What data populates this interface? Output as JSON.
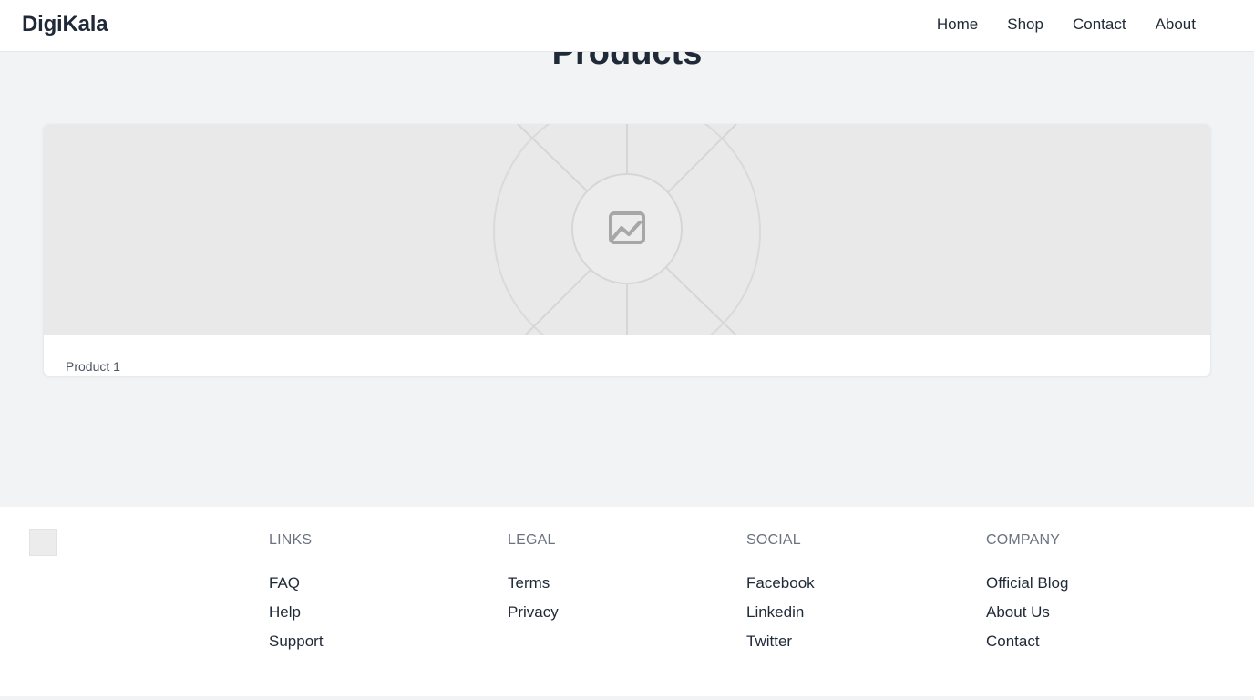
{
  "header": {
    "brand": "DigiKala",
    "nav": [
      {
        "label": "Home"
      },
      {
        "label": "Shop"
      },
      {
        "label": "Contact"
      },
      {
        "label": "About"
      }
    ]
  },
  "main": {
    "title": "Products",
    "products": [
      {
        "name": "Product 1",
        "image_icon": "image-placeholder-icon"
      }
    ]
  },
  "footer": {
    "logo_icon": "broken-image-icon",
    "columns": [
      {
        "heading": "LINKS",
        "links": [
          "FAQ",
          "Help",
          "Support"
        ]
      },
      {
        "heading": "LEGAL",
        "links": [
          "Terms",
          "Privacy"
        ]
      },
      {
        "heading": "SOCIAL",
        "links": [
          "Facebook",
          "Linkedin",
          "Twitter"
        ]
      },
      {
        "heading": "COMPANY",
        "links": [
          "Official Blog",
          "About Us",
          "Contact"
        ]
      }
    ]
  },
  "colors": {
    "page_bg": "#f2f3f5",
    "text": "#1f2937",
    "muted": "#6b7280",
    "placeholder_bg": "#e9e9e9"
  }
}
